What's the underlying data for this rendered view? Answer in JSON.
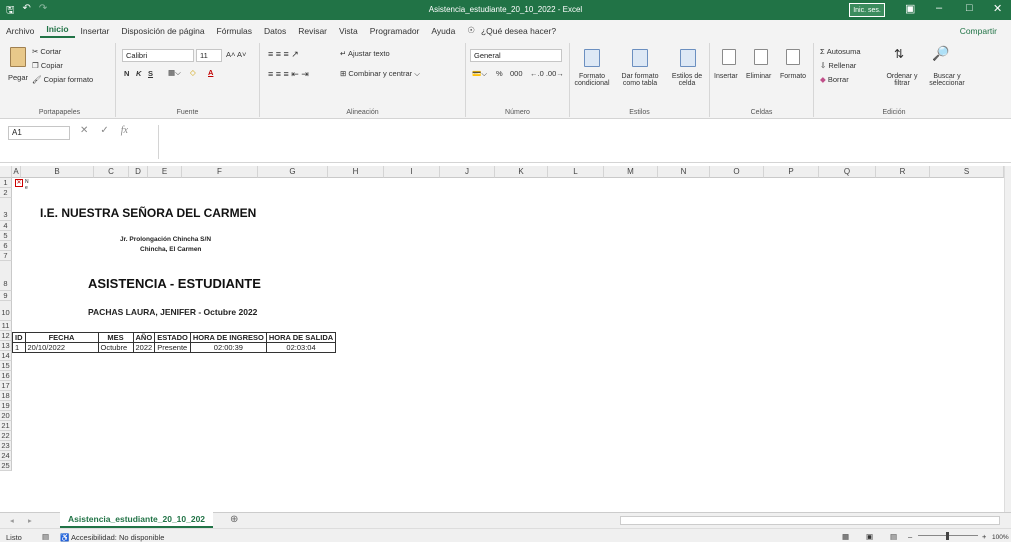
{
  "window": {
    "title": "Asistencia_estudiante_20_10_2022  -  Excel",
    "sign_in": "Inic. ses."
  },
  "menu": [
    "Archivo",
    "Inicio",
    "Insertar",
    "Disposición de página",
    "Fórmulas",
    "Datos",
    "Revisar",
    "Vista",
    "Programador",
    "Ayuda"
  ],
  "tell_me": "¿Qué desea hacer?",
  "share": "Compartir",
  "ribbon": {
    "clipboard": {
      "paste": "Pegar",
      "cut": "Cortar",
      "copy": "Copiar",
      "format_painter": "Copiar formato",
      "label": "Portapapeles"
    },
    "font": {
      "name": "Calibri",
      "size": "11",
      "label": "Fuente",
      "bold": "N",
      "italic": "K",
      "underline": "S"
    },
    "alignment": {
      "wrap": "Ajustar texto",
      "merge": "Combinar y centrar",
      "label": "Alineación"
    },
    "number": {
      "format": "General",
      "label": "Número",
      "percent": "%",
      "thousands": "000"
    },
    "styles": {
      "conditional": "Formato condicional",
      "table": "Dar formato como tabla",
      "cell": "Estilos de celda",
      "label": "Estilos"
    },
    "cells": {
      "insert": "Insertar",
      "delete": "Eliminar",
      "format": "Formato",
      "label": "Celdas"
    },
    "editing": {
      "autosum": "Autosuma",
      "fill": "Rellenar",
      "clear": "Borrar",
      "sort": "Ordenar y filtrar",
      "find": "Buscar y seleccionar",
      "label": "Edición"
    }
  },
  "formula_bar": {
    "name_box": "A1",
    "fx": "fx",
    "content": ""
  },
  "columns": [
    "A",
    "B",
    "C",
    "D",
    "E",
    "F",
    "G",
    "H",
    "I",
    "J",
    "K",
    "L",
    "M",
    "N",
    "O",
    "P",
    "Q",
    "R",
    "S"
  ],
  "rows": [
    "1",
    "2",
    "3",
    "4",
    "5",
    "6",
    "7",
    "8",
    "9",
    "10",
    "11",
    "12",
    "13",
    "14",
    "15",
    "16",
    "17",
    "18",
    "19",
    "20",
    "21",
    "22",
    "23",
    "24",
    "25"
  ],
  "sheet": {
    "logo_alt": "N e",
    "school": "I.E. NUESTRA SEÑORA DEL CARMEN",
    "address1": "Jr. Prolongación Chincha S/N",
    "address2": "Chincha, El Carmen",
    "heading": "ASISTENCIA - ESTUDIANTE",
    "student": "PACHAS LAURA, JENIFER - Octubre 2022",
    "table_headers": [
      "ID",
      "FECHA",
      "MES",
      "AÑO",
      "ESTADO",
      "HORA DE INGRESO",
      "HORA DE SALIDA"
    ],
    "table_rows": [
      [
        "1",
        "20/10/2022",
        "Octubre",
        "2022",
        "Presente",
        "02:00:39",
        "02:03:04"
      ]
    ]
  },
  "sheet_tab": "Asistencia_estudiante_20_10_202",
  "status": {
    "ready": "Listo",
    "accessibility": "Accesibilidad: No disponible",
    "zoom": "100%"
  }
}
